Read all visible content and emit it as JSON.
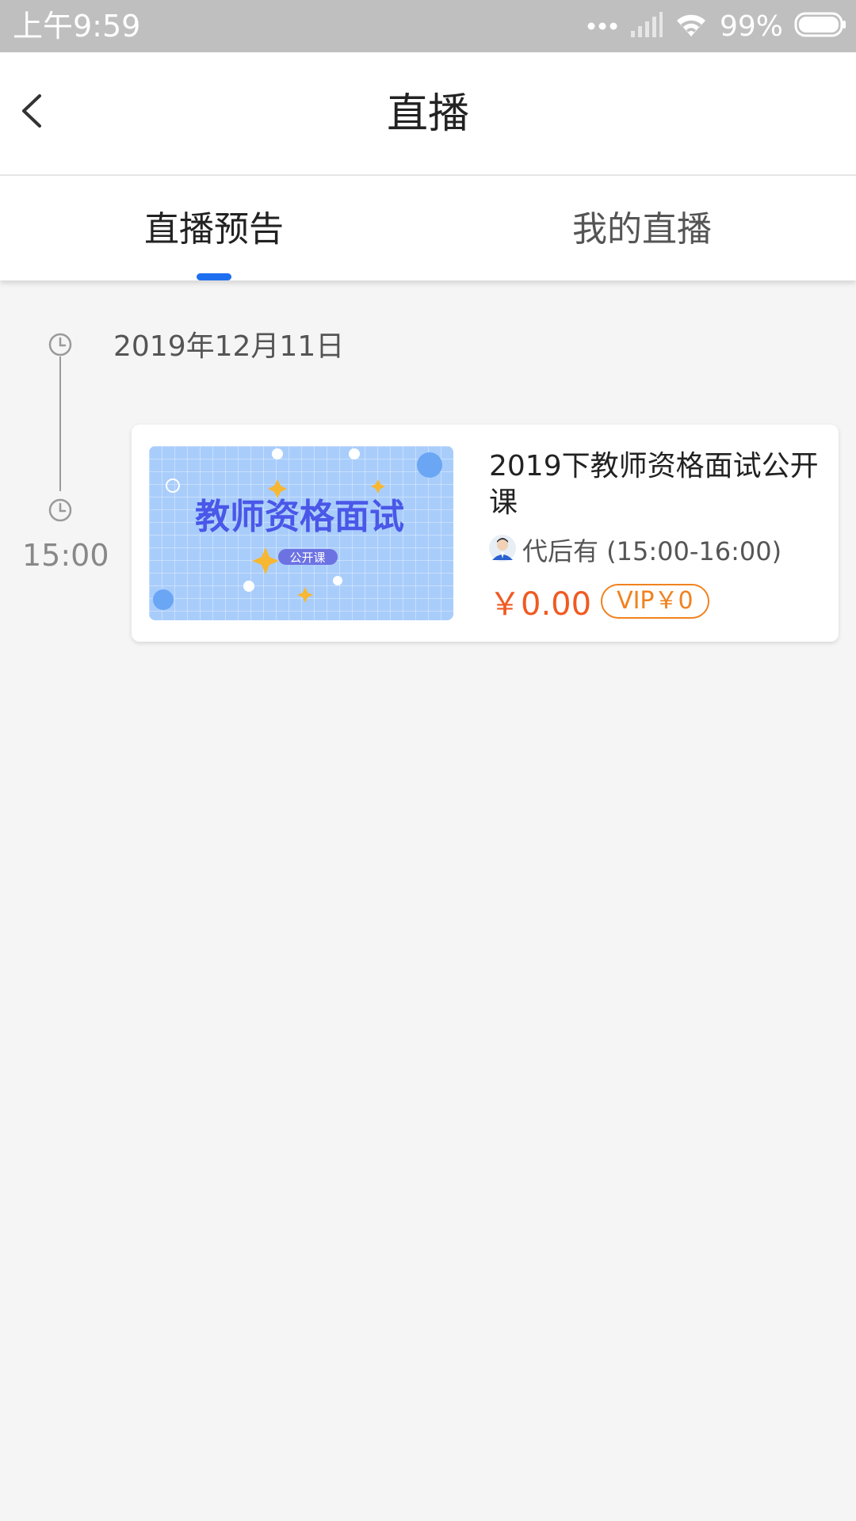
{
  "status_bar": {
    "time": "上午9:59",
    "battery": "99%",
    "icons": [
      "dots-icon",
      "signal-icon",
      "wifi-icon",
      "battery-icon"
    ]
  },
  "header": {
    "title": "直播",
    "back_icon": "chevron-left-icon"
  },
  "tabs": [
    {
      "label": "直播预告",
      "active": true
    },
    {
      "label": "我的直播",
      "active": false
    }
  ],
  "timeline": {
    "date": "2019年12月11日",
    "time": "15:00",
    "icon": "clock-icon"
  },
  "course": {
    "title": "2019下教师资格面试公开课",
    "thumb_title": "教师资格面试",
    "thumb_tag": "公开课",
    "teacher": "代后有 (15:00-16:00)",
    "price": "￥0.00",
    "vip_price": "VIP￥0"
  },
  "colors": {
    "accent": "#1e6ff0",
    "price": "#f05a22",
    "vip": "#f0821e",
    "status_bar": "#bfbfbf"
  }
}
